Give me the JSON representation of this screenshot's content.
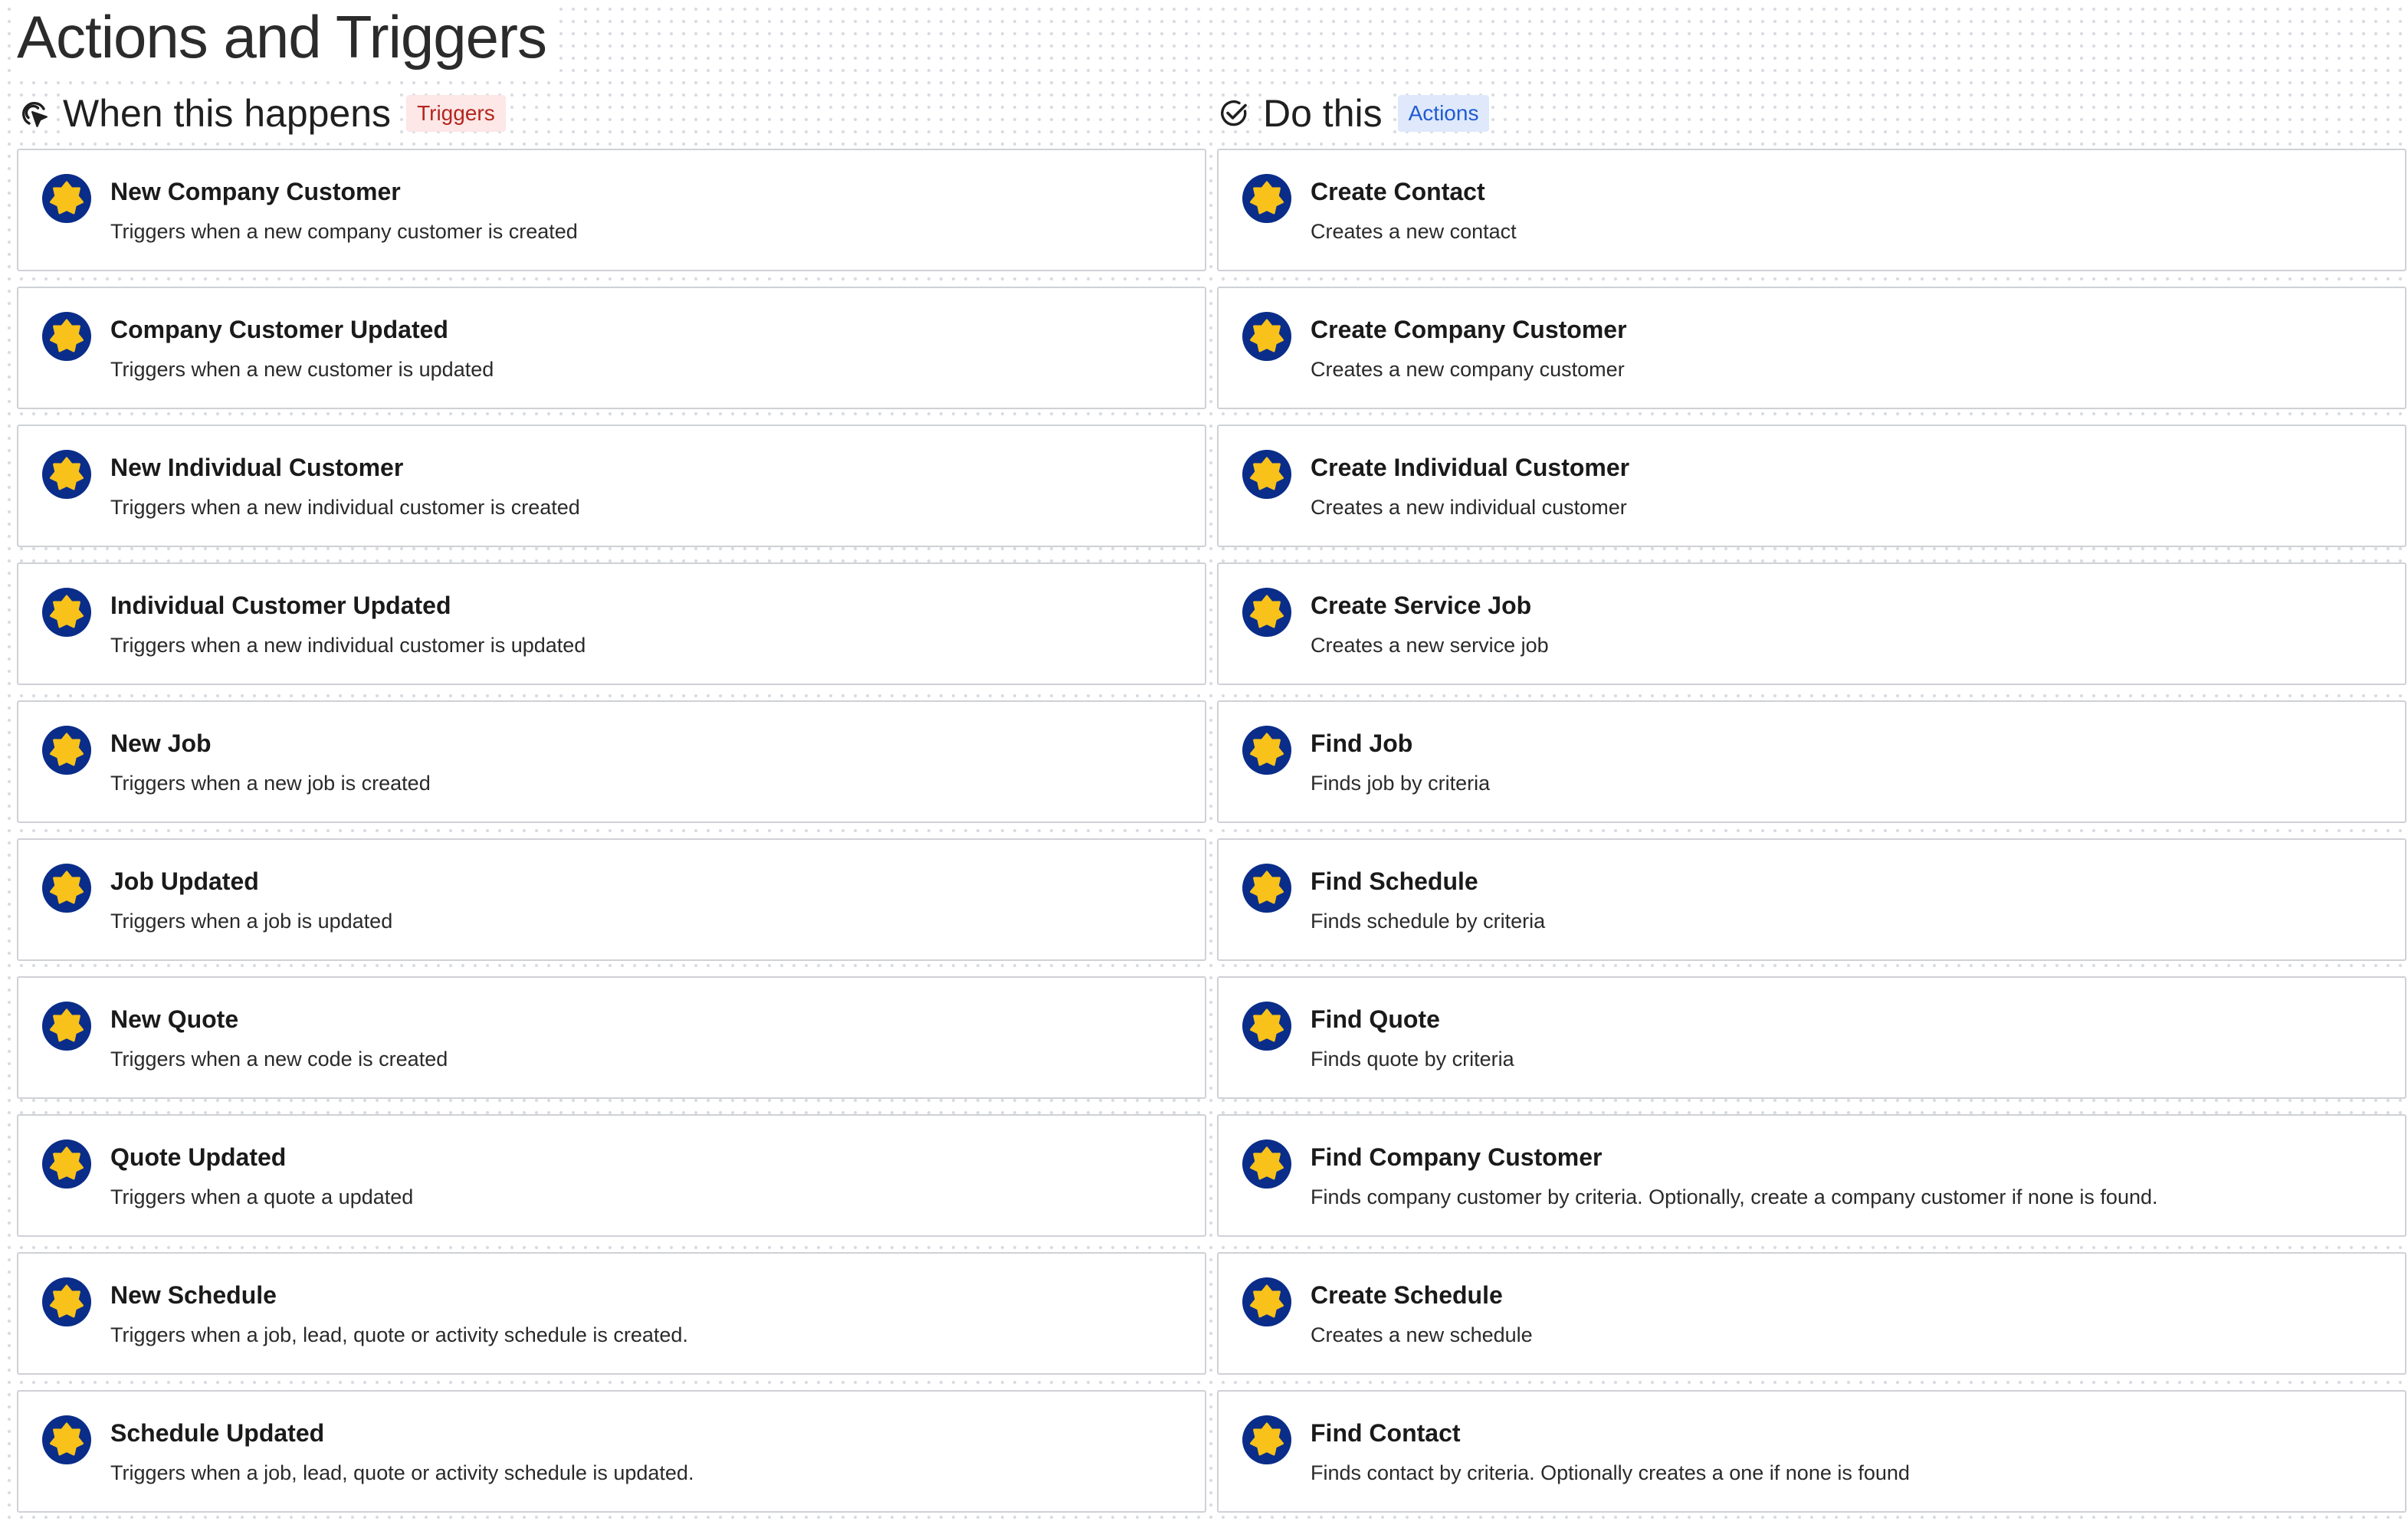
{
  "page": {
    "title": "Actions and Triggers"
  },
  "colors": {
    "icon_ring": "#0a2d8a",
    "icon_star": "#f9c21a",
    "triggers_badge_bg": "#fde7e7",
    "triggers_badge_text": "#b3261e",
    "actions_badge_bg": "#dfe9fb",
    "actions_badge_text": "#1f5ad1",
    "card_border": "#cfd1d6"
  },
  "triggers": {
    "heading": "When this happens",
    "badge": "Triggers",
    "icon": "cursor-click-icon",
    "items": [
      {
        "title": "New Company Customer",
        "description": "Triggers when a new company customer is created",
        "icon": "app-logo-star-icon"
      },
      {
        "title": "Company Customer Updated",
        "description": "Triggers when a new customer is updated",
        "icon": "app-logo-star-icon"
      },
      {
        "title": "New Individual Customer",
        "description": "Triggers when a new individual customer is created",
        "icon": "app-logo-star-icon"
      },
      {
        "title": "Individual Customer Updated",
        "description": "Triggers when a new individual customer is updated",
        "icon": "app-logo-star-icon"
      },
      {
        "title": "New Job",
        "description": "Triggers when a new job is created",
        "icon": "app-logo-star-icon"
      },
      {
        "title": "Job Updated",
        "description": "Triggers when a job is updated",
        "icon": "app-logo-star-icon"
      },
      {
        "title": "New Quote",
        "description": "Triggers when a new code is created",
        "icon": "app-logo-star-icon"
      },
      {
        "title": "Quote Updated",
        "description": "Triggers when a quote a updated",
        "icon": "app-logo-star-icon"
      },
      {
        "title": "New Schedule",
        "description": "Triggers when a job, lead, quote or activity schedule is created.",
        "icon": "app-logo-star-icon"
      },
      {
        "title": "Schedule Updated",
        "description": "Triggers when a job, lead, quote or activity schedule is updated.",
        "icon": "app-logo-star-icon"
      }
    ]
  },
  "actions": {
    "heading": "Do this",
    "badge": "Actions",
    "icon": "check-circle-icon",
    "items": [
      {
        "title": "Create Contact",
        "description": "Creates a new contact",
        "icon": "app-logo-star-icon"
      },
      {
        "title": "Create Company Customer",
        "description": "Creates a new company customer",
        "icon": "app-logo-star-icon"
      },
      {
        "title": "Create Individual Customer",
        "description": "Creates a new individual customer",
        "icon": "app-logo-star-icon"
      },
      {
        "title": "Create Service Job",
        "description": "Creates a new service job",
        "icon": "app-logo-star-icon"
      },
      {
        "title": "Find Job",
        "description": "Finds job by criteria",
        "icon": "app-logo-star-icon"
      },
      {
        "title": "Find Schedule",
        "description": "Finds schedule by criteria",
        "icon": "app-logo-star-icon"
      },
      {
        "title": "Find Quote",
        "description": "Finds quote by criteria",
        "icon": "app-logo-star-icon"
      },
      {
        "title": "Find Company Customer",
        "description": "Finds company customer by criteria. Optionally, create a company customer if none is found.",
        "icon": "app-logo-star-icon"
      },
      {
        "title": "Create Schedule",
        "description": "Creates a new schedule",
        "icon": "app-logo-star-icon"
      },
      {
        "title": "Find Contact",
        "description": "Finds contact by criteria. Optionally creates a one if none is found",
        "icon": "app-logo-star-icon"
      }
    ]
  }
}
